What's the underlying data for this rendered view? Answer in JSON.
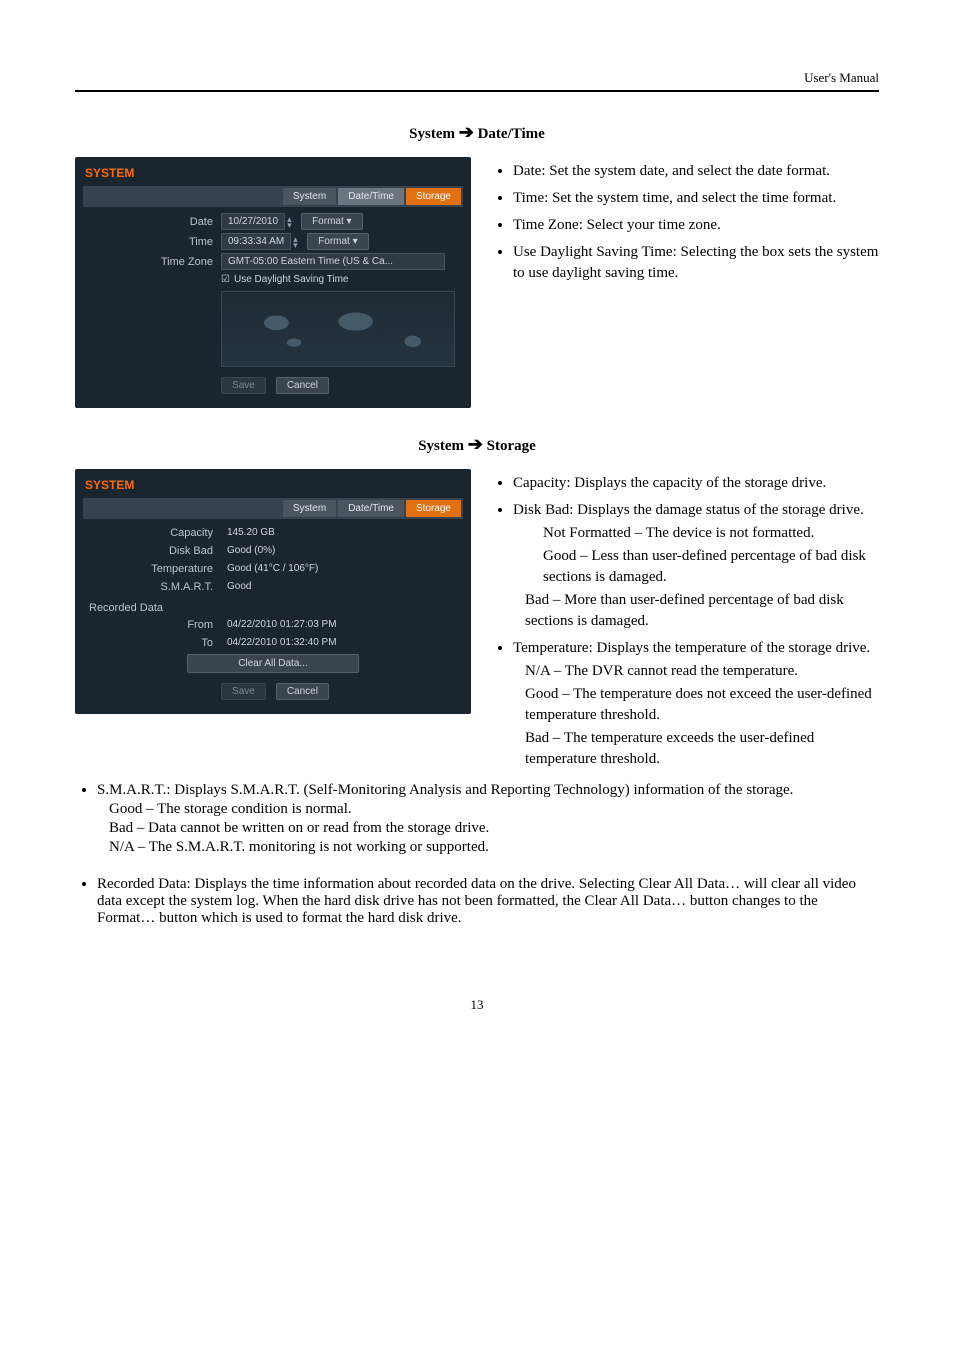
{
  "header": {
    "left": "",
    "right": "User's Manual"
  },
  "section1": {
    "title_left": "System ",
    "title_right": " Date/Time",
    "ss": {
      "window_title": "SYSTEM",
      "tabs": {
        "system": "System",
        "datetime": "Date/Time",
        "storage": "Storage"
      },
      "date_label": "Date",
      "date_value": "10/27/2010",
      "format_btn": "Format",
      "time_label": "Time",
      "time_value": "09:33:34 AM",
      "tz_label": "Time Zone",
      "tz_value": "GMT-05:00  Eastern Time (US & Ca...",
      "dst_label": "Use Daylight Saving Time",
      "save": "Save",
      "cancel": "Cancel"
    },
    "bullets": {
      "date_term": "Date",
      "date_desc": ":  Set the system date, and select the date format.",
      "time_term": "Time",
      "time_desc": ":  Set the system time, and select the time format.",
      "tz_term": "Time Zone",
      "tz_desc": ":  Select your time zone.",
      "dst_term": "Use Daylight Saving Time",
      "dst_desc": ":  Selecting the box sets the system to use daylight saving time."
    }
  },
  "section2": {
    "title_left": "System ",
    "title_right": " Storage",
    "ss": {
      "window_title": "SYSTEM",
      "tabs": {
        "system": "System",
        "datetime": "Date/Time",
        "storage": "Storage"
      },
      "capacity_label": "Capacity",
      "capacity_value": "145.20 GB",
      "diskbad_label": "Disk Bad",
      "diskbad_value": "Good (0%)",
      "temp_label": "Temperature",
      "temp_value": "Good (41°C / 106°F)",
      "smart_label": "S.M.A.R.T.",
      "smart_value": "Good",
      "recorded_data": "Recorded Data",
      "from_label": "From",
      "from_value": "04/22/2010  01:27:03 PM",
      "to_label": "To",
      "to_value": "04/22/2010  01:32:40 PM",
      "clear_btn": "Clear All Data...",
      "save": "Save",
      "cancel": "Cancel"
    },
    "bullets_right": {
      "capacity_term": "Capacity",
      "capacity_desc": ":  Displays the capacity of the storage drive.",
      "diskbad_term": "Disk Bad",
      "diskbad_desc": ":  Displays the damage status of the storage drive.",
      "diskbad_nf": "Not Formatted",
      "diskbad_nf_d": " – The device is not formatted.",
      "diskbad_good": "Good",
      "diskbad_good_d": " – Less than user-defined percentage of bad disk sections is damaged.",
      "diskbad_bad": "Bad",
      "diskbad_bad_d": " – More than user-defined percentage of bad disk sections is damaged.",
      "temp_term": "Temperature",
      "temp_desc": ":  Displays the temperature of the storage drive.",
      "temp_na": "N/A",
      "temp_na_d": " – The DVR cannot read the temperature.",
      "temp_good": "Good",
      "temp_good_d": " – The temperature does not exceed the user-defined temperature threshold.",
      "temp_bad": "Bad",
      "temp_bad_d": " – The temperature exceeds the user-defined temperature threshold."
    },
    "bullets_full": {
      "smart_term": "S.M.A.R.T.",
      "smart_desc": ":  Displays S.M.A.R.T. (Self-Monitoring Analysis and Reporting Technology) information of the storage.",
      "smart_good": "Good",
      "smart_good_d": " – The storage condition is normal.",
      "smart_bad": "Bad",
      "smart_bad_d": " – Data cannot be written on or read from the storage drive.",
      "smart_na": "N/A",
      "smart_na_d": " – The S.M.A.R.T. monitoring is not working or supported.",
      "rec_term": "Recorded Data",
      "rec_desc1": ":  Displays the time information about recorded data on the drive.  Selecting ",
      "rec_clear": "Clear All Data…",
      "rec_desc2": " will clear all video data except the system log.  When the hard disk drive has not been formatted, the ",
      "rec_clear2": "Clear All Data…",
      "rec_desc3": " button changes to the ",
      "rec_format": "Format…",
      "rec_desc4": " button which is used to format the hard disk drive."
    }
  },
  "page_number": "13"
}
